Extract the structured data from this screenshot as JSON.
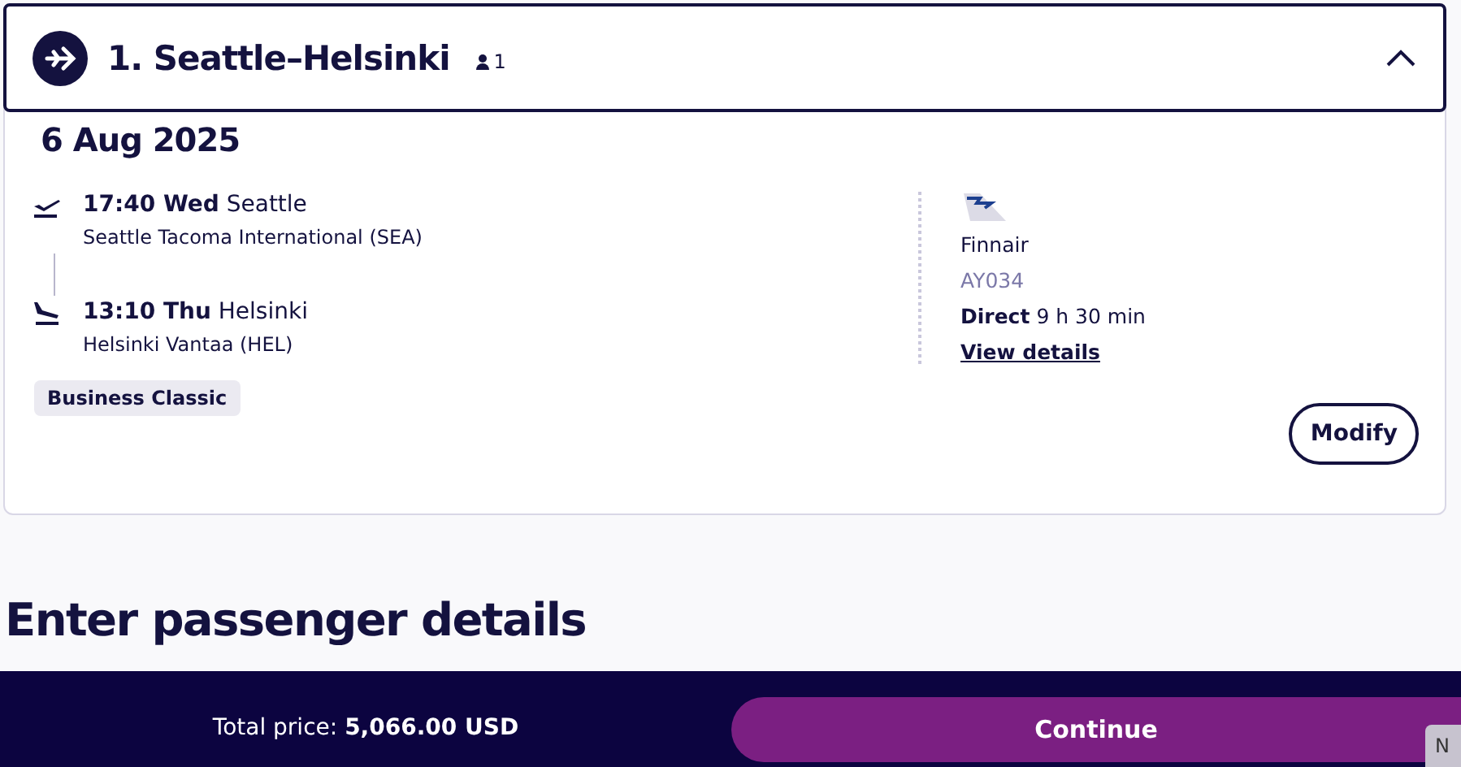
{
  "flight": {
    "title": "1. Seattle–Helsinki",
    "passengers": "1",
    "expanded": true,
    "date": "6 Aug 2025",
    "segments": [
      {
        "kind": "departure",
        "time": "17:40 Wed",
        "city": "Seattle",
        "airport": "Seattle Tacoma International (SEA)"
      },
      {
        "kind": "arrival",
        "time": "13:10 Thu",
        "city": "Helsinki",
        "airport": "Helsinki Vantaa (HEL)"
      }
    ],
    "cabin": "Business Classic",
    "airline": "Finnair",
    "flight_number": "AY034",
    "stops": "Direct",
    "duration": "9 h 30 min",
    "details_link": "View details",
    "modify_button": "Modify"
  },
  "section_heading": "Enter passenger details",
  "footer": {
    "total_label": "Total price:",
    "total_value": "5,066.00 USD",
    "continue_button": "Continue",
    "corner_tab": "N"
  }
}
